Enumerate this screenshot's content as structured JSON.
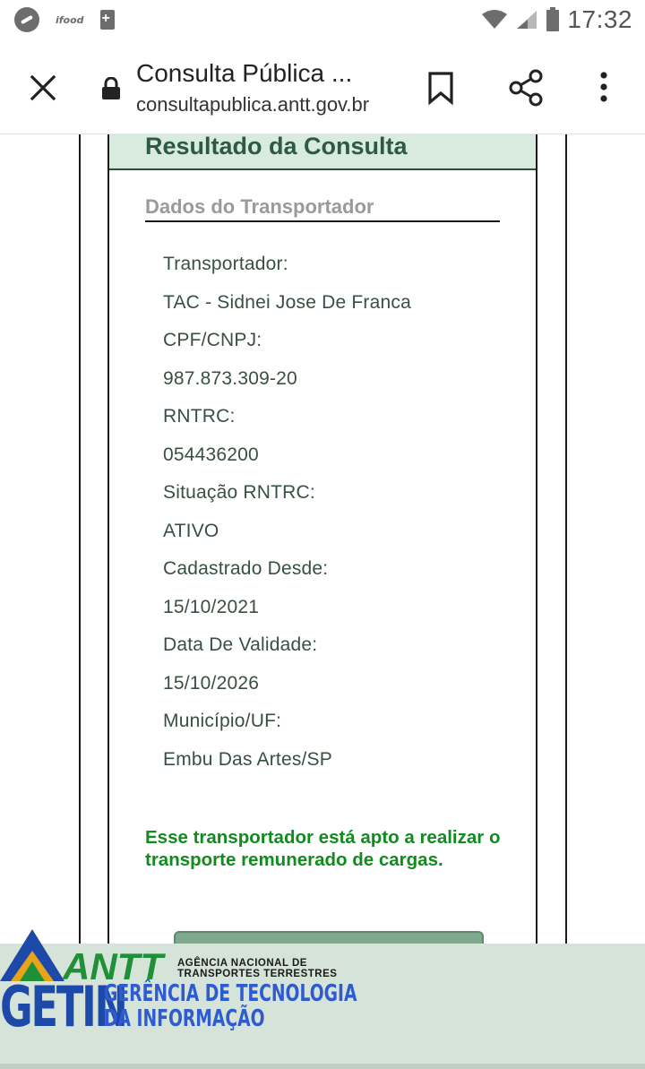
{
  "status_bar": {
    "ifood_label": "ifood",
    "time": "17:32"
  },
  "browser": {
    "title": "Consulta Pública ...",
    "url": "consultapublica.antt.gov.br",
    "icons": [
      "close-icon",
      "lock-icon",
      "bookmark-icon",
      "share-icon",
      "more-vert-icon"
    ]
  },
  "card": {
    "title": "Resultado da Consulta",
    "section_title": "Dados do Transportador",
    "fields": [
      {
        "label": "Transportador:",
        "value": "TAC - Sidnei Jose De Franca"
      },
      {
        "label": "CPF/CNPJ:",
        "value": "987.873.309-20"
      },
      {
        "label": "RNTRC:",
        "value": "054436200"
      },
      {
        "label": "Situação RNTRC:",
        "value": "ATIVO"
      },
      {
        "label": "Cadastrado Desde:",
        "value": "15/10/2021"
      },
      {
        "label": "Data De Validade:",
        "value": "15/10/2026"
      },
      {
        "label": "Município/UF:",
        "value": "Embu Das Artes/SP"
      }
    ],
    "notice": "Esse transportador está apto a realizar o transporte remunerado de cargas."
  },
  "banner": {
    "antt_label": "ANTT",
    "agency_line1": "AGÊNCIA NACIONAL DE",
    "agency_line2": "TRANSPORTES TERRESTRES",
    "getin": "GETIN",
    "getin_line1": "GERÊNCIA DE TECNOLOGIA",
    "getin_line2": "DA INFORMAÇÃO"
  },
  "colors": {
    "header_bg": "#d9ebdf",
    "title_green": "#2d5a40",
    "field_text": "#38503f",
    "notice_green": "#118a1e",
    "antt_green": "#1f8f3a",
    "getin_blue": "#1d4aa8"
  }
}
